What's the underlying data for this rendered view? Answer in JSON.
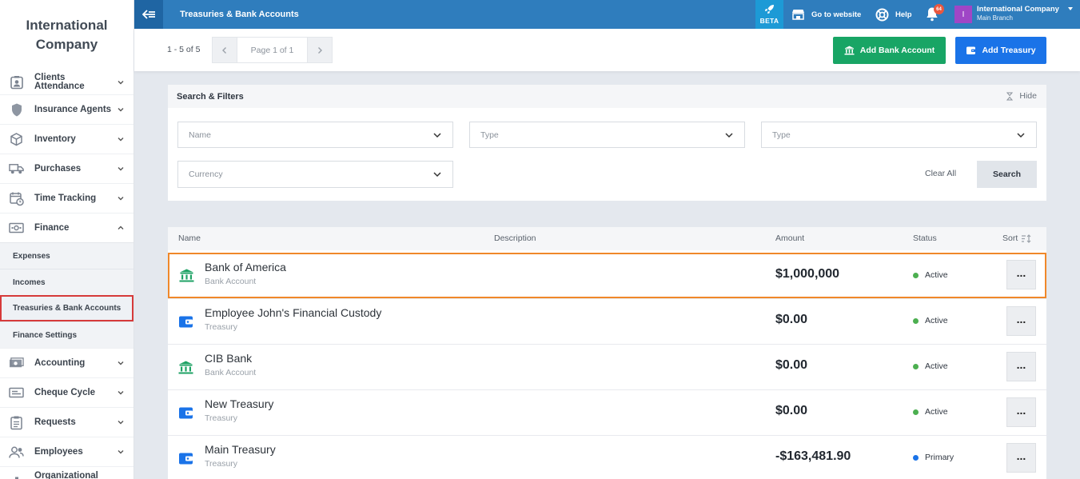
{
  "sidebar": {
    "brand": "International Company",
    "items": [
      {
        "label": "Clients Attendance",
        "icon": "attendance-icon"
      },
      {
        "label": "Insurance Agents",
        "icon": "shield-icon"
      },
      {
        "label": "Inventory",
        "icon": "box-icon"
      },
      {
        "label": "Purchases",
        "icon": "truck-icon"
      },
      {
        "label": "Time Tracking",
        "icon": "calendar-clock-icon"
      },
      {
        "label": "Finance",
        "icon": "cash-icon"
      }
    ],
    "finance_sub": [
      {
        "label": "Expenses"
      },
      {
        "label": "Incomes"
      },
      {
        "label": "Treasuries & Bank Accounts"
      },
      {
        "label": "Finance Settings"
      }
    ],
    "items_after": [
      {
        "label": "Accounting",
        "icon": "money-icon"
      },
      {
        "label": "Cheque Cycle",
        "icon": "cheque-icon"
      },
      {
        "label": "Requests",
        "icon": "clipboard-icon"
      },
      {
        "label": "Employees",
        "icon": "users-icon"
      },
      {
        "label": "Organizational",
        "icon": "org-icon"
      }
    ]
  },
  "topbar": {
    "title": "Treasuries & Bank Accounts",
    "beta_label": "BETA",
    "website_label": "Go to website",
    "help_label": "Help",
    "notification_count": "64",
    "avatar_letter": "I",
    "company_name": "International Company",
    "branch_name": "Main Branch"
  },
  "subheader": {
    "range": "1 - 5 of 5",
    "page_label": "Page 1 of 1",
    "add_bank_label": "Add Bank Account",
    "add_treasury_label": "Add Treasury"
  },
  "filters": {
    "title": "Search & Filters",
    "hide_label": "Hide",
    "name_placeholder": "Name",
    "type1_placeholder": "Type",
    "type2_placeholder": "Type",
    "currency_placeholder": "Currency",
    "clear_label": "Clear All",
    "search_label": "Search"
  },
  "table": {
    "columns": {
      "name": "Name",
      "description": "Description",
      "amount": "Amount",
      "status": "Status",
      "sort": "Sort"
    },
    "rows": [
      {
        "name": "Bank of America",
        "type": "Bank Account",
        "amount": "$1,000,000",
        "status": "Active",
        "icon": "bank-icon"
      },
      {
        "name": "Employee John's Financial Custody",
        "type": "Treasury",
        "amount": "$0.00",
        "status": "Active",
        "icon": "wallet-icon"
      },
      {
        "name": "CIB Bank",
        "type": "Bank Account",
        "amount": "$0.00",
        "status": "Active",
        "icon": "bank-icon"
      },
      {
        "name": "New Treasury",
        "type": "Treasury",
        "amount": "$0.00",
        "status": "Active",
        "icon": "wallet-icon"
      },
      {
        "name": "Main Treasury",
        "type": "Treasury",
        "amount": "-$163,481.90",
        "status": "Primary",
        "icon": "wallet-icon"
      }
    ]
  },
  "colors": {
    "topbar": "#2f7dbd",
    "green_button": "#18a565",
    "blue_button": "#1a73e8",
    "active_dot": "#4caf50",
    "primary_dot": "#1a73e8",
    "highlight_border": "#f0882a",
    "selected_sub_border": "#d63a3a"
  }
}
